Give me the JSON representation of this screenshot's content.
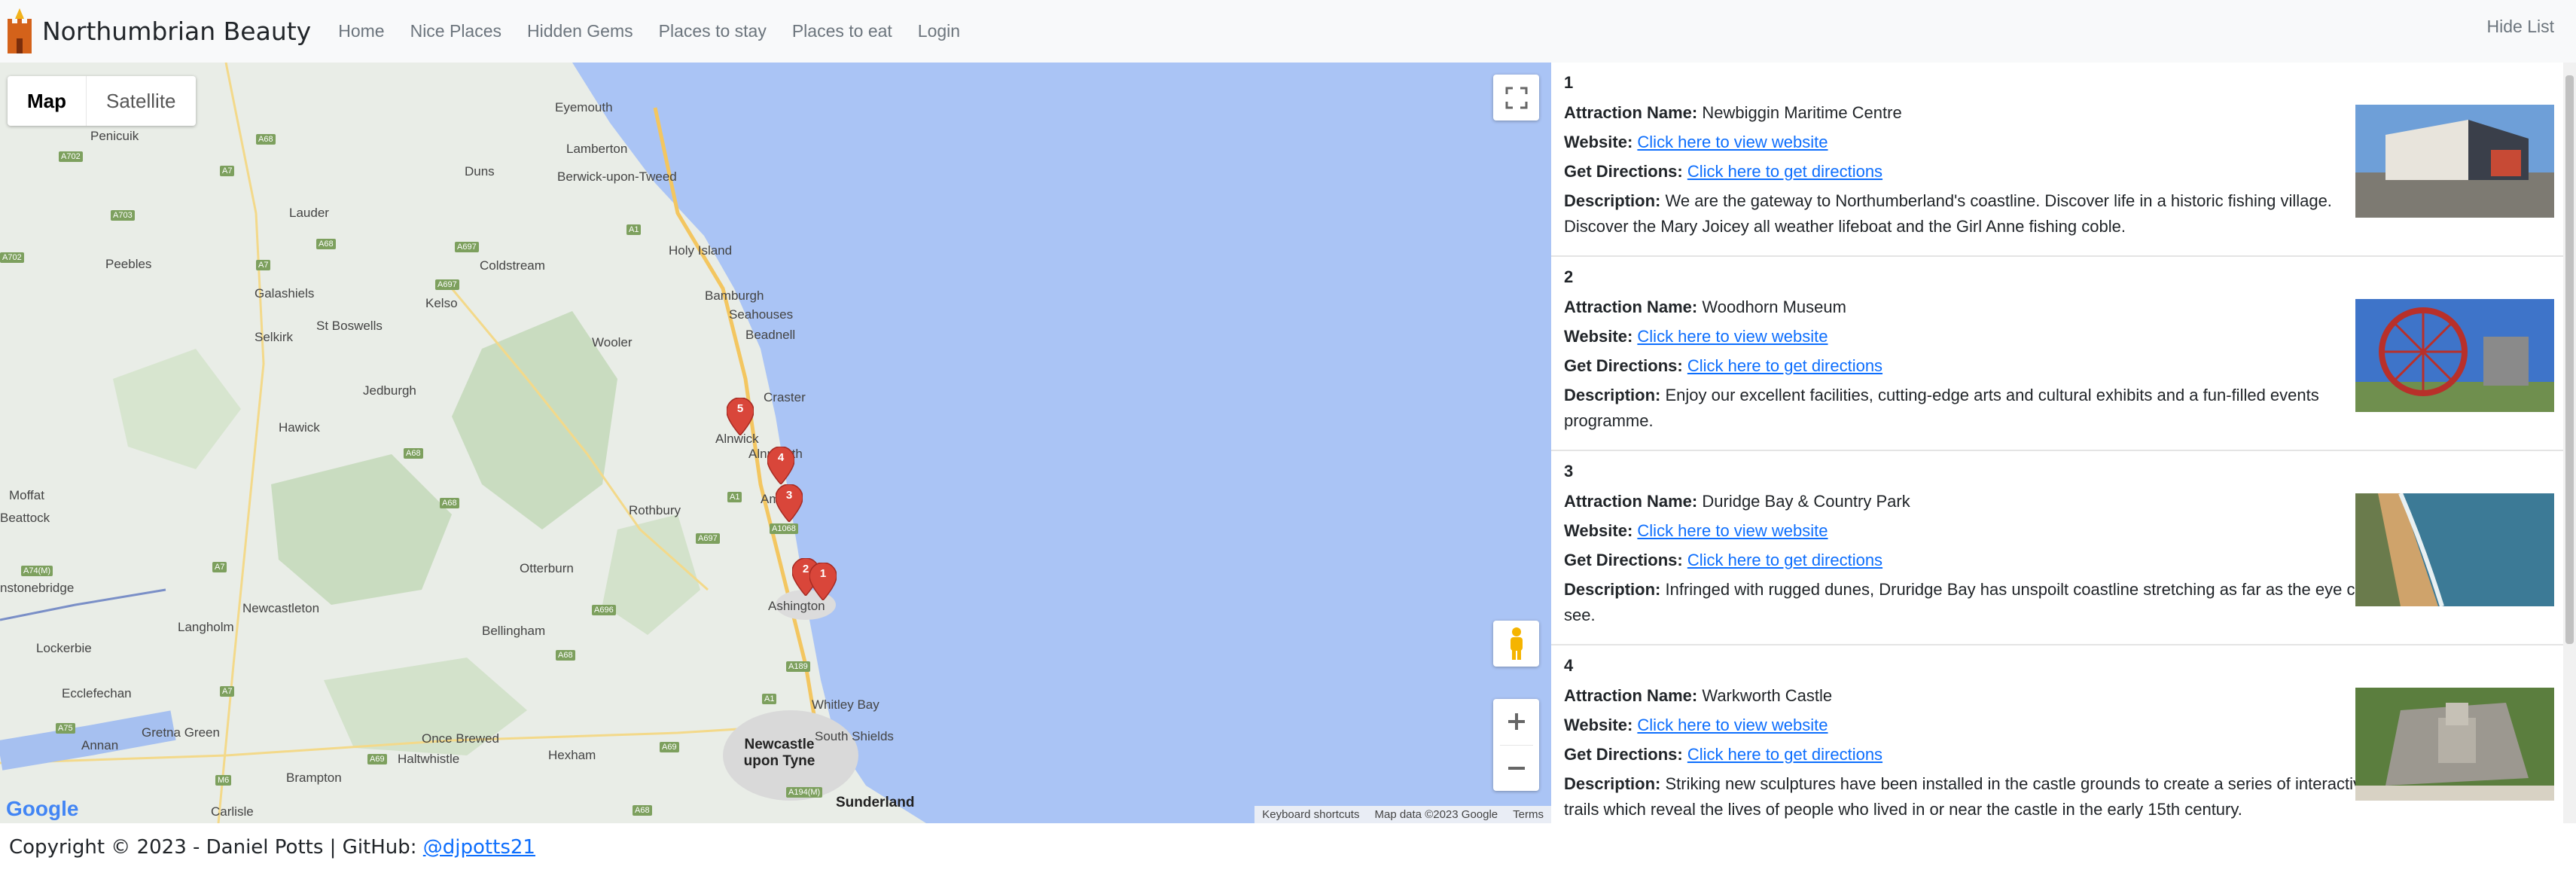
{
  "navbar": {
    "brand": "Northumbrian Beauty",
    "links": [
      "Home",
      "Nice Places",
      "Hidden Gems",
      "Places to stay",
      "Places to eat",
      "Login"
    ],
    "hide_list": "Hide List"
  },
  "map": {
    "type_map": "Map",
    "type_satellite": "Satellite",
    "keyboard_shortcuts": "Keyboard shortcuts",
    "map_data": "Map data ©2023 Google",
    "terms": "Terms",
    "google": "Google",
    "places": [
      "Eyemouth",
      "Penicuik",
      "Lamberton",
      "Duns",
      "Berwick-upon-Tweed",
      "Lauder",
      "Holy Island",
      "Peebles",
      "Coldstream",
      "Galashiels",
      "Kelso",
      "Bamburgh",
      "Seahouses",
      "Beadnell",
      "Selkirk",
      "St Boswells",
      "Wooler",
      "Craster",
      "Jedburgh",
      "Alnwick",
      "Hawick",
      "Alnmouth",
      "Amble",
      "Moffat",
      "Rothbury",
      "Beattock",
      "Otterburn",
      "Ashington",
      "Newcastleton",
      "Langholm",
      "Bellingham",
      "Lockerbie",
      "Whitley Bay",
      "Ecclefechan",
      "South Shields",
      "Gretna Green",
      "Once Brewed",
      "Hexham",
      "Annan",
      "Haltwhistle",
      "Newcastle upon Tyne",
      "Brampton",
      "Carlisle",
      "Sunderland",
      "nstonebridge"
    ],
    "roads": [
      "A68",
      "A702",
      "A7",
      "A703",
      "A68",
      "A697",
      "A1",
      "A697",
      "A7",
      "A702",
      "A68",
      "A68",
      "A697",
      "A1",
      "A1068",
      "A74(M)",
      "A7",
      "A696",
      "A68",
      "A189",
      "A7",
      "A69",
      "A69",
      "A1",
      "A75",
      "M6",
      "A194(M)",
      "A68"
    ],
    "marker_labels": [
      "5",
      "4",
      "3",
      "2",
      "1"
    ]
  },
  "list": {
    "attraction_label": "Attraction Name:",
    "website_label": "Website:",
    "directions_label": "Get Directions:",
    "description_label": "Description:",
    "website_link": "Click here to view website",
    "directions_link": "Click here to get directions",
    "items": [
      {
        "num": "1",
        "name": "Newbiggin Maritime Centre",
        "description": "We are the gateway to Northumberland's coastline. Discover life in a historic fishing village. Discover the Mary Joicey all weather lifeboat and the Girl Anne fishing coble."
      },
      {
        "num": "2",
        "name": "Woodhorn Museum",
        "description": "Enjoy our excellent facilities, cutting-edge arts and cultural exhibits and a fun-filled events programme."
      },
      {
        "num": "3",
        "name": "Duridge Bay & Country Park",
        "description": "Infringed with rugged dunes, Druridge Bay has unspoilt coastline stretching as far as the eye can see."
      },
      {
        "num": "4",
        "name": "Warkworth Castle",
        "description": "Striking new sculptures have been installed in the castle grounds to create a series of interactive trails which reveal the lives of people who lived in or near the castle in the early 15th century."
      }
    ]
  },
  "footer": {
    "text": "Copyright © 2023 - Daniel Potts | GitHub:",
    "github": "@djpotts21"
  },
  "colors": {
    "sea": "#aac4f5",
    "land": "#e9ede7",
    "marker": "#d9463a",
    "link": "#0d6efd"
  }
}
